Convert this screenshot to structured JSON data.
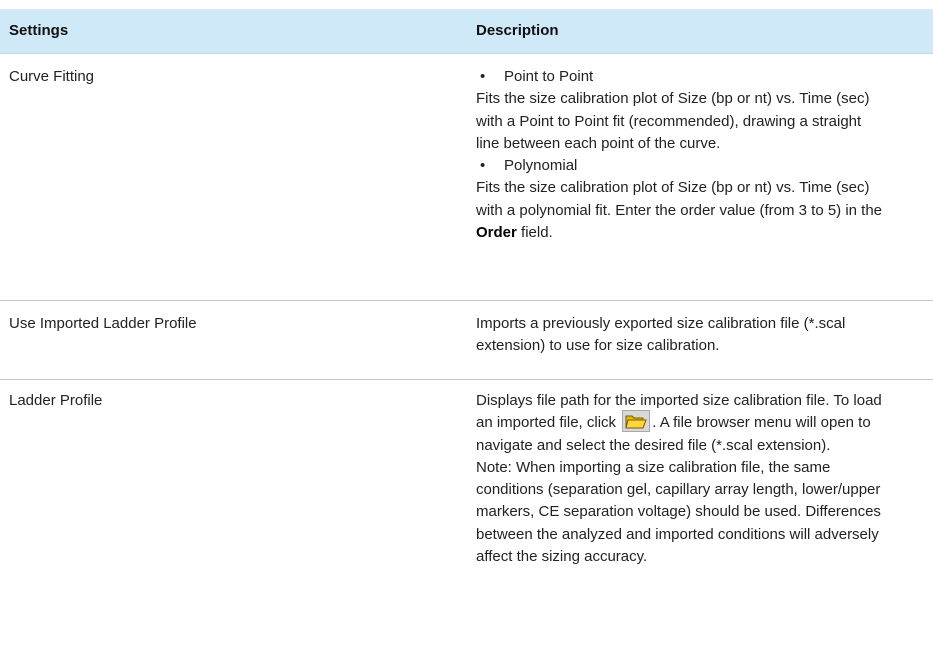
{
  "header": {
    "col1": "Settings",
    "col2": "Description"
  },
  "rows": [
    {
      "setting": "Curve Fitting",
      "bullet1": "Point to Point",
      "desc1": "Fits the size calibration plot of Size (bp or nt) vs. Time (sec) with a Point to Point fit (recommended), drawing a straight line between each point of the curve.",
      "bullet2": "Polynomial",
      "desc2_pre": "Fits the size calibration plot of Size (bp or nt) vs. Time (sec) with a polynomial fit. Enter the order value (from 3 to 5) in the",
      "desc2_bold": "Order",
      "desc2_post": "field."
    },
    {
      "setting": "Use Imported Ladder Profile",
      "desc": "Imports a previously exported size calibration file (*.scal extension) to use for size calibration."
    },
    {
      "setting": "Ladder Profile",
      "desc_pre": "Displays file path for the imported size calibration file. To load an imported file, click",
      "desc_post": ". A file browser menu will open to navigate and select the desired file (*.scal extension).",
      "note": "Note: When importing a size calibration file, the same conditions (separation gel, capillary array length, lower/upper markers, CE separation voltage) should be used. Differences between the analyzed and imported conditions will adversely affect the sizing accuracy."
    }
  ],
  "icons": {
    "open_folder": "open-folder-icon",
    "folder_color": "#e8b800"
  },
  "colors": {
    "header_bg": "#cfe9f9"
  }
}
